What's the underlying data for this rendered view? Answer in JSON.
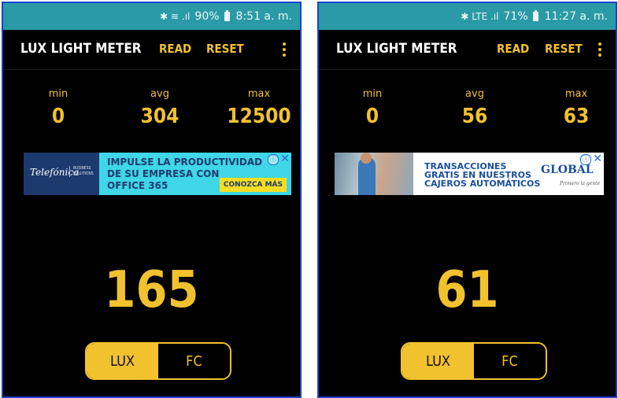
{
  "screens": [
    {
      "status": {
        "icons": "✱ ≋ .ıl",
        "battery": "90%",
        "time": "8:51 a. m."
      },
      "toolbar": {
        "title": "LUX LIGHT METER",
        "read_label": "READ",
        "reset_label": "RESET"
      },
      "stats": {
        "min_label": "min",
        "min_value": "0",
        "avg_label": "avg",
        "avg_value": "304",
        "max_label": "max",
        "max_value": "12500"
      },
      "ad": {
        "brand": "Telefónica",
        "brand_sub": "BUSINESS SOLUTIONS",
        "headline": [
          "IMPULSE LA PRODUCTIVIDAD",
          "DE SU EMPRESA CON",
          "OFFICE 365"
        ],
        "cta": "CONOZCA MÁS",
        "adchoices": "ⓘ",
        "close": "✕"
      },
      "reading": "165",
      "units": {
        "lux": "LUX",
        "fc": "FC",
        "selected": "LUX"
      }
    },
    {
      "status": {
        "icons": "✱ LTE .ıl",
        "battery": "71%",
        "time": "11:27 a. m."
      },
      "toolbar": {
        "title": "LUX LIGHT METER",
        "read_label": "READ",
        "reset_label": "RESET"
      },
      "stats": {
        "min_label": "min",
        "min_value": "0",
        "avg_label": "avg",
        "avg_value": "56",
        "max_label": "max",
        "max_value": "63"
      },
      "ad": {
        "headline": [
          "TRANSACCIONES",
          "GRATIS EN NUESTROS",
          "CAJEROS AUTOMÁTICOS"
        ],
        "brand": "GLOBAL",
        "slogan": "Primero la gente",
        "adchoices": "ⓘ",
        "close": "✕"
      },
      "reading": "61",
      "units": {
        "lux": "LUX",
        "fc": "FC",
        "selected": "LUX"
      }
    }
  ],
  "colors": {
    "accent": "#f2c12e",
    "statusbar": "#2a9aa7",
    "background": "#000000",
    "frame": "#1d3fcf"
  }
}
